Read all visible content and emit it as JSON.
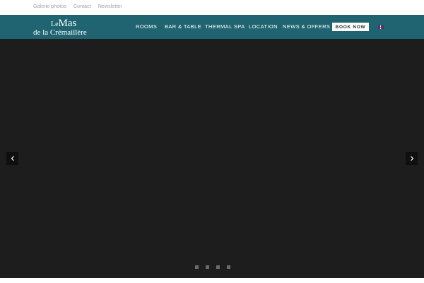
{
  "top_links": [
    "Galerie photos",
    "Contact",
    "Newsletter"
  ],
  "logo": {
    "line1_small": "Le",
    "line1_big": "Mas",
    "line2": "de la Crémaillère"
  },
  "nav": {
    "items": [
      "ROOMS",
      "BAR & TABLE",
      "THERMAL SPA",
      "LOCATION",
      "NEWS & OFFERS"
    ],
    "book_label": "BOOK NOW",
    "language_icon": "uk-flag-icon"
  },
  "slider": {
    "prev_icon": "chevron-left-icon",
    "next_icon": "chevron-right-icon",
    "slide_count": 4
  },
  "colors": {
    "header_bg": "#1f6470",
    "slider_bg": "#1d1d1d",
    "book_button_bg": "#ffffff",
    "dot": "#6a6a6a"
  }
}
